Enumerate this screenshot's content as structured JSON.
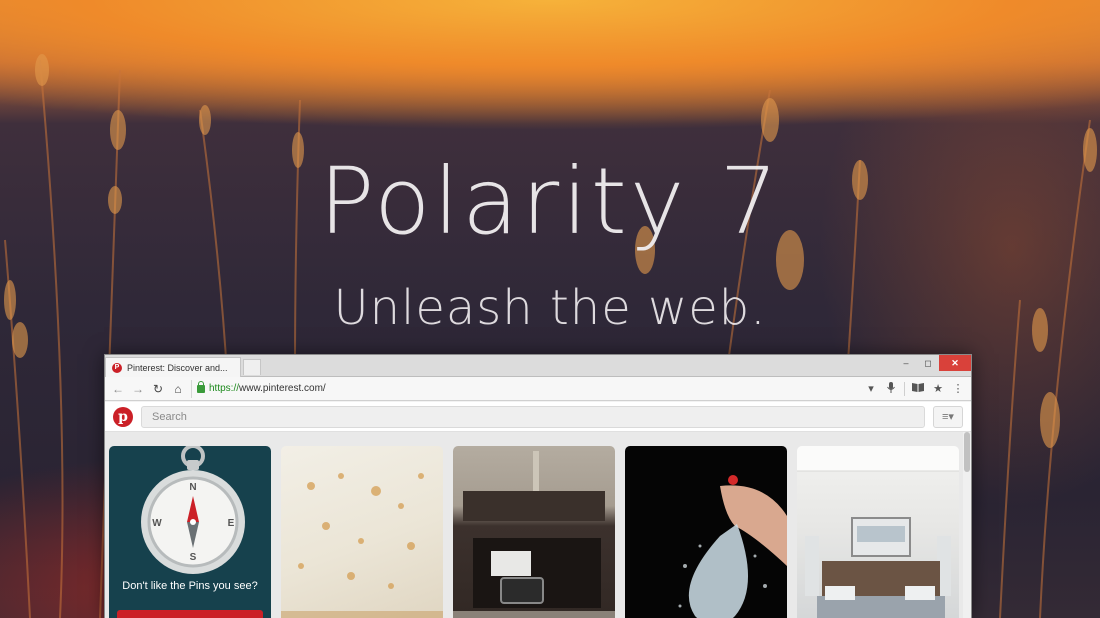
{
  "hero": {
    "title": "Polarity  7",
    "subtitle": "Unleash the web."
  },
  "browser": {
    "tab_title": "Pinterest: Discover and...",
    "tab_favicon": "P",
    "url_scheme": "https://",
    "url_host": "www.pinterest.com/",
    "window_controls": {
      "minimize": "–",
      "restore": "◻",
      "close": "✕"
    },
    "nav": {
      "back": "←",
      "forward": "→",
      "reload": "↻",
      "home": "⌂"
    },
    "toolbar_icons": {
      "dropdown": "▾",
      "mic": "🎤",
      "reader": "📖",
      "star": "★",
      "menu": "⋮"
    }
  },
  "pinterest": {
    "logo": "p",
    "search_placeholder": "Search",
    "menu_icon": "≡▾",
    "compass_card_caption": "Don't like the Pins you see?",
    "compass_letters": {
      "n": "N",
      "e": "E",
      "s": "S",
      "w": "W"
    }
  },
  "colors": {
    "pinterest_red": "#cb2027",
    "close_button": "#d9413a",
    "secure_green": "#1e8a1e"
  }
}
